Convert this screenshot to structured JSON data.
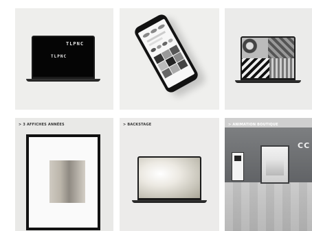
{
  "tiles": [
    {
      "logo_text": "TLPNC",
      "logo_text_2": "TLPNC"
    },
    {},
    {},
    {
      "caption": "> 3 AFFICHES ANNÉES"
    },
    {
      "caption": "> BACKSTAGE"
    },
    {
      "caption": "> ANIMATION BOUTIQUE",
      "store_name": "CC"
    }
  ]
}
